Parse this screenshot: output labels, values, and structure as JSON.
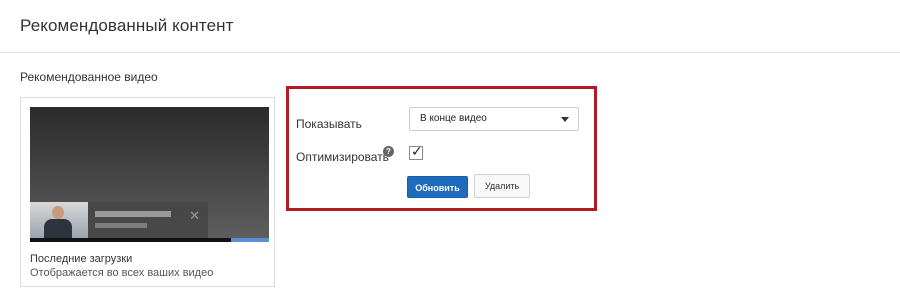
{
  "header": {
    "title": "Рекомендованный контент"
  },
  "featured_video": {
    "section_title": "Рекомендованное видео",
    "card_title": "Последние загрузки",
    "card_subtitle": "Отображается во всех ваших видео",
    "close_icon": "close-icon"
  },
  "settings": {
    "show_label": "Показывать",
    "show_value": "В конце видео",
    "optimize_label": "Оптимизировать",
    "help_icon_glyph": "?",
    "optimize_checked": true,
    "update_label": "Обновить",
    "delete_label": "Удалить"
  },
  "colors": {
    "accent": "#1f6cbf",
    "highlight_border": "#b11b25"
  }
}
